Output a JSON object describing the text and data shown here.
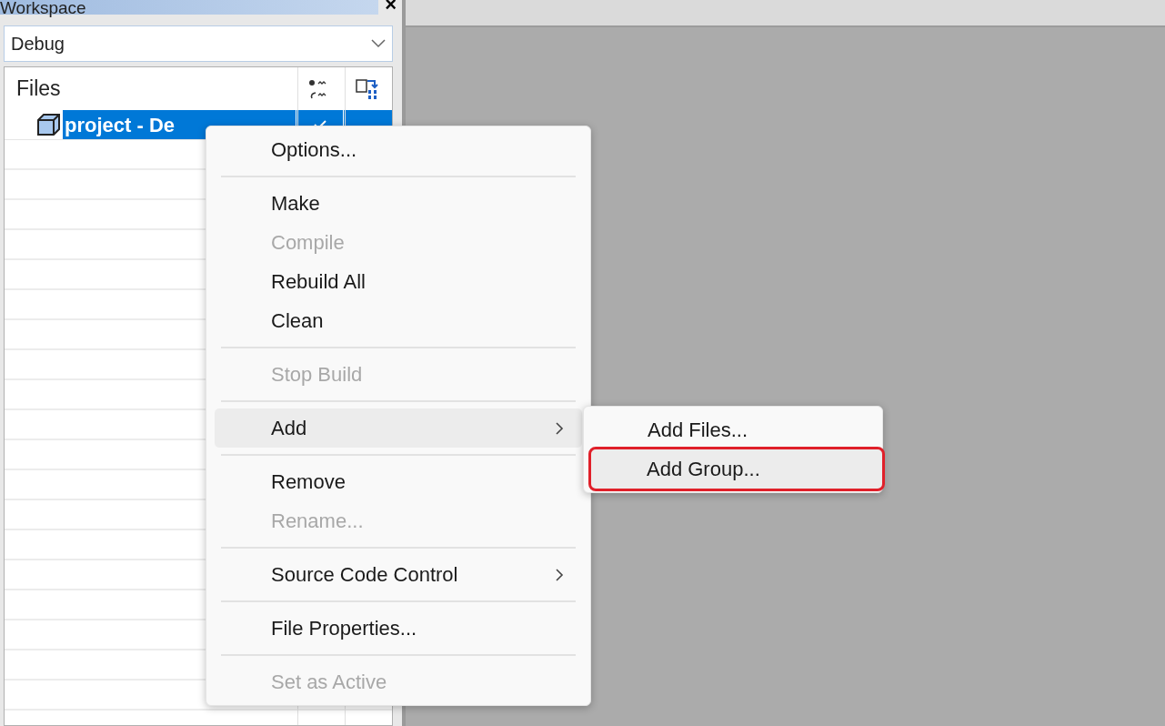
{
  "workspace": {
    "title": "Workspace",
    "close": "×",
    "configuration": "Debug",
    "tree": {
      "header": "Files",
      "items": [
        {
          "label": "project - De",
          "selected": true,
          "checked": true
        }
      ]
    }
  },
  "context_menu": {
    "items": [
      {
        "kind": "item",
        "label": "Options...",
        "disabled": false,
        "selected": false,
        "submenu": false
      },
      {
        "kind": "separator"
      },
      {
        "kind": "item",
        "label": "Make",
        "disabled": false,
        "selected": false,
        "submenu": false
      },
      {
        "kind": "item",
        "label": "Compile",
        "disabled": true,
        "selected": false,
        "submenu": false
      },
      {
        "kind": "item",
        "label": "Rebuild All",
        "disabled": false,
        "selected": false,
        "submenu": false
      },
      {
        "kind": "item",
        "label": "Clean",
        "disabled": false,
        "selected": false,
        "submenu": false
      },
      {
        "kind": "separator"
      },
      {
        "kind": "item",
        "label": "Stop Build",
        "disabled": true,
        "selected": false,
        "submenu": false
      },
      {
        "kind": "separator"
      },
      {
        "kind": "item",
        "label": "Add",
        "disabled": false,
        "selected": true,
        "submenu": true
      },
      {
        "kind": "separator"
      },
      {
        "kind": "item",
        "label": "Remove",
        "disabled": false,
        "selected": false,
        "submenu": false
      },
      {
        "kind": "item",
        "label": "Rename...",
        "disabled": true,
        "selected": false,
        "submenu": false
      },
      {
        "kind": "separator"
      },
      {
        "kind": "item",
        "label": "Source Code Control",
        "disabled": false,
        "selected": false,
        "submenu": true
      },
      {
        "kind": "separator"
      },
      {
        "kind": "item",
        "label": "File Properties...",
        "disabled": false,
        "selected": false,
        "submenu": false
      },
      {
        "kind": "separator"
      },
      {
        "kind": "item",
        "label": "Set as Active",
        "disabled": true,
        "selected": false,
        "submenu": false
      }
    ]
  },
  "submenu": {
    "items": [
      {
        "label": "Add Files...",
        "selected": false,
        "outlined": false
      },
      {
        "label": "Add Group...",
        "selected": true,
        "outlined": true
      }
    ]
  }
}
